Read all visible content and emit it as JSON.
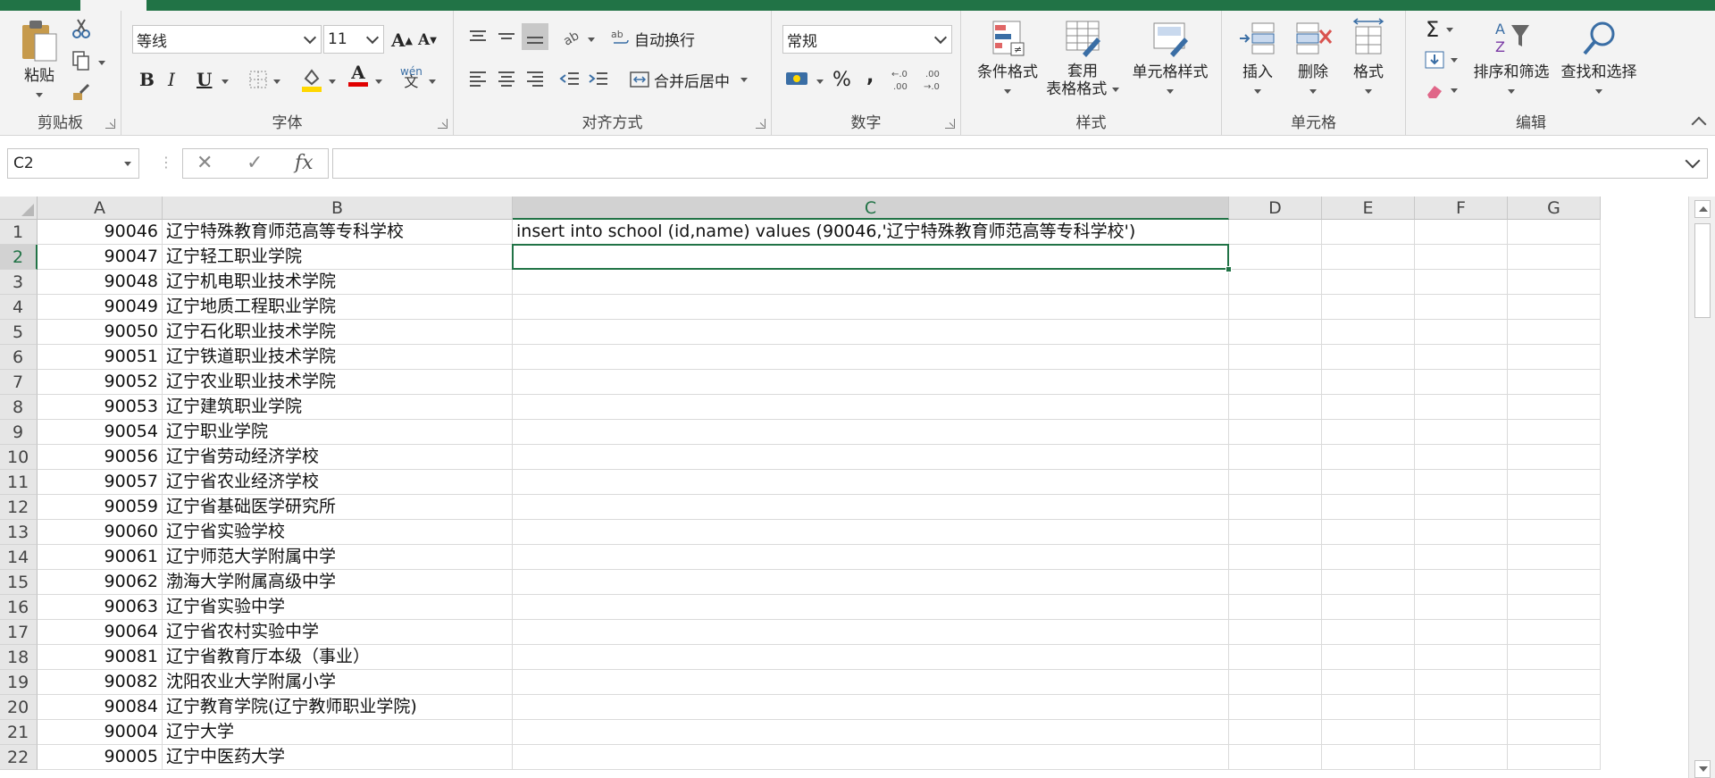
{
  "ribbon": {
    "clipboard": {
      "paste_label": "粘贴",
      "group_label": "剪贴板"
    },
    "font": {
      "font_name": "等线",
      "font_size": "11",
      "grow_label": "A",
      "shrink_label": "A",
      "bold_label": "B",
      "italic_label": "I",
      "underline_label": "U",
      "font_color_label": "A",
      "phonetic_label": "wén",
      "group_label": "字体"
    },
    "alignment": {
      "wrap_text_label": "自动换行",
      "merge_center_label": "合并后居中",
      "group_label": "对齐方式"
    },
    "number": {
      "format_value": "常规",
      "percent_label": "%",
      "comma_label": ",",
      "group_label": "数字"
    },
    "styles": {
      "conditional_label": "条件格式",
      "table_format_label_1": "套用",
      "table_format_label_2": "表格格式",
      "cell_styles_label": "单元格样式",
      "group_label": "样式"
    },
    "cells": {
      "insert_label": "插入",
      "delete_label": "删除",
      "format_label": "格式",
      "group_label": "单元格"
    },
    "editing": {
      "sum_label": "Σ",
      "sort_filter_label": "排序和筛选",
      "find_select_label": "查找和选择",
      "group_label": "编辑"
    }
  },
  "formula_bar": {
    "name_box": "C2",
    "fx_label": "fx",
    "cancel_label": "✕",
    "enter_label": "✓",
    "formula": ""
  },
  "columns": [
    "A",
    "B",
    "C",
    "D",
    "E",
    "F",
    "G"
  ],
  "selected_column": "C",
  "selected_row": "2",
  "rows": [
    {
      "n": "1",
      "a": "90046",
      "b": "辽宁特殊教育师范高等专科学校",
      "c": "insert into school (id,name) values (90046,'辽宁特殊教育师范高等专科学校')"
    },
    {
      "n": "2",
      "a": "90047",
      "b": "辽宁轻工职业学院",
      "c": ""
    },
    {
      "n": "3",
      "a": "90048",
      "b": "辽宁机电职业技术学院",
      "c": ""
    },
    {
      "n": "4",
      "a": "90049",
      "b": "辽宁地质工程职业学院",
      "c": ""
    },
    {
      "n": "5",
      "a": "90050",
      "b": "辽宁石化职业技术学院",
      "c": ""
    },
    {
      "n": "6",
      "a": "90051",
      "b": "辽宁铁道职业技术学院",
      "c": ""
    },
    {
      "n": "7",
      "a": "90052",
      "b": "辽宁农业职业技术学院",
      "c": ""
    },
    {
      "n": "8",
      "a": "90053",
      "b": "辽宁建筑职业学院",
      "c": ""
    },
    {
      "n": "9",
      "a": "90054",
      "b": "辽宁职业学院",
      "c": ""
    },
    {
      "n": "10",
      "a": "90056",
      "b": "辽宁省劳动经济学校",
      "c": ""
    },
    {
      "n": "11",
      "a": "90057",
      "b": "辽宁省农业经济学校",
      "c": ""
    },
    {
      "n": "12",
      "a": "90059",
      "b": "辽宁省基础医学研究所",
      "c": ""
    },
    {
      "n": "13",
      "a": "90060",
      "b": "辽宁省实验学校",
      "c": ""
    },
    {
      "n": "14",
      "a": "90061",
      "b": "辽宁师范大学附属中学",
      "c": ""
    },
    {
      "n": "15",
      "a": "90062",
      "b": "渤海大学附属高级中学",
      "c": ""
    },
    {
      "n": "16",
      "a": "90063",
      "b": "辽宁省实验中学",
      "c": ""
    },
    {
      "n": "17",
      "a": "90064",
      "b": "辽宁省农村实验中学",
      "c": ""
    },
    {
      "n": "18",
      "a": "90081",
      "b": "辽宁省教育厅本级（事业）",
      "c": ""
    },
    {
      "n": "19",
      "a": "90082",
      "b": "沈阳农业大学附属小学",
      "c": ""
    },
    {
      "n": "20",
      "a": "90084",
      "b": "辽宁教育学院(辽宁教师职业学院)",
      "c": ""
    },
    {
      "n": "21",
      "a": "90004",
      "b": "辽宁大学",
      "c": ""
    },
    {
      "n": "22",
      "a": "90005",
      "b": "辽宁中医药大学",
      "c": ""
    }
  ],
  "colors": {
    "accent": "#217346",
    "ribbon_bg": "#f3f3f3"
  }
}
